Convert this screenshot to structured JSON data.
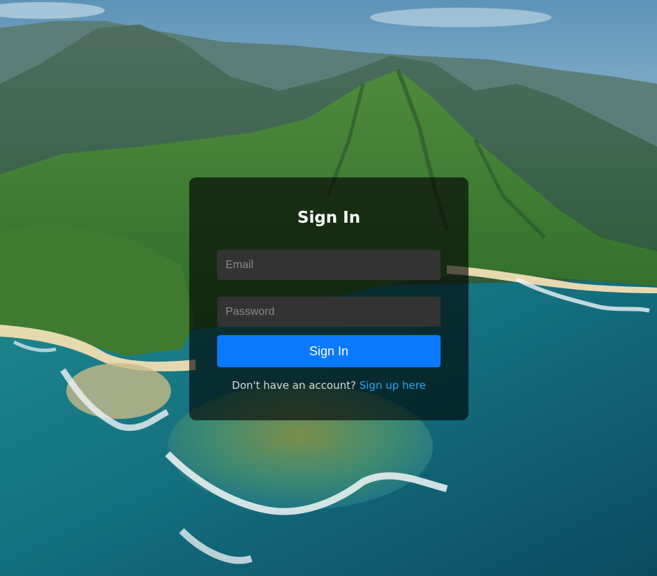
{
  "signin": {
    "title": "Sign In",
    "email_placeholder": "Email",
    "password_placeholder": "Password",
    "submit_label": "Sign In",
    "footer_text": "Don't have an account?",
    "signup_link": "Sign up here"
  },
  "colors": {
    "accent": "#0a78ff",
    "link": "#1ea7ff",
    "card_bg": "rgba(0,0,0,0.62)",
    "field_bg": "#333333"
  }
}
